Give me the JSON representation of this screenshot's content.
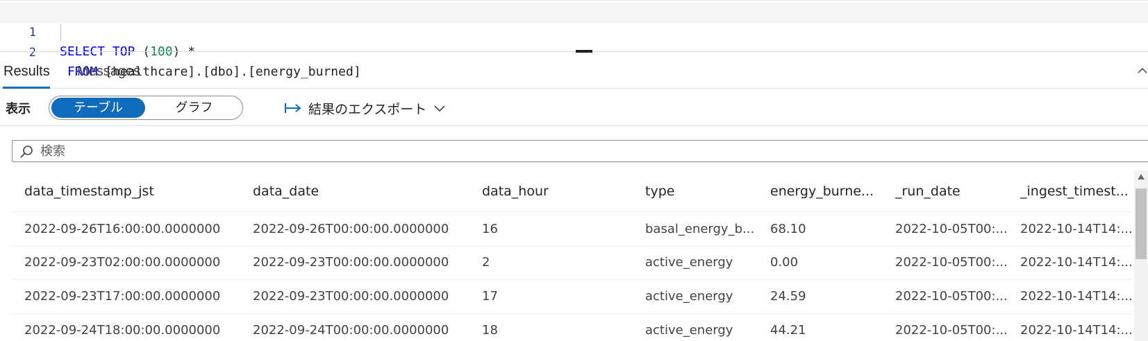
{
  "editor": {
    "lines": [
      {
        "number": "1",
        "keyword1": "SELECT",
        "keyword2": "TOP",
        "paren_open": " (",
        "number_value": "100",
        "rest": ") *"
      },
      {
        "number": "2",
        "keyword": "FROM",
        "rest": " [healthcare].[dbo].[energy_burned]"
      }
    ]
  },
  "tabs": {
    "results": "Results",
    "messages": "Messages",
    "active": "Results"
  },
  "toolbar": {
    "view_label": "表示",
    "toggle": {
      "table": "テーブル",
      "graph": "グラフ",
      "selected": "テーブル"
    },
    "export_label": "結果のエクスポート"
  },
  "search": {
    "placeholder": "検索",
    "value": ""
  },
  "table": {
    "columns": [
      "data_timestamp_jst",
      "data_date",
      "data_hour",
      "type",
      "energy_burne...",
      "_run_date",
      "_ingest_timest..."
    ],
    "rows": [
      [
        "2022-09-26T16:00:00.0000000",
        "2022-09-26T00:00:00.0000000",
        "16",
        "basal_energy_b...",
        "68.10",
        "2022-10-05T00:...",
        "2022-10-14T14:..."
      ],
      [
        "2022-09-23T02:00:00.0000000",
        "2022-09-23T00:00:00.0000000",
        "2",
        "active_energy",
        "0.00",
        "2022-10-05T00:...",
        "2022-10-14T14:..."
      ],
      [
        "2022-09-23T17:00:00.0000000",
        "2022-09-23T00:00:00.0000000",
        "17",
        "active_energy",
        "24.59",
        "2022-10-05T00:...",
        "2022-10-14T14:..."
      ],
      [
        "2022-09-24T18:00:00.0000000",
        "2022-09-24T00:00:00.0000000",
        "18",
        "active_energy",
        "44.21",
        "2022-10-05T00:...",
        "2022-10-14T14:..."
      ]
    ]
  },
  "colors": {
    "accent": "#0f6cbd",
    "keyword": "#0000ff",
    "number": "#098658"
  }
}
